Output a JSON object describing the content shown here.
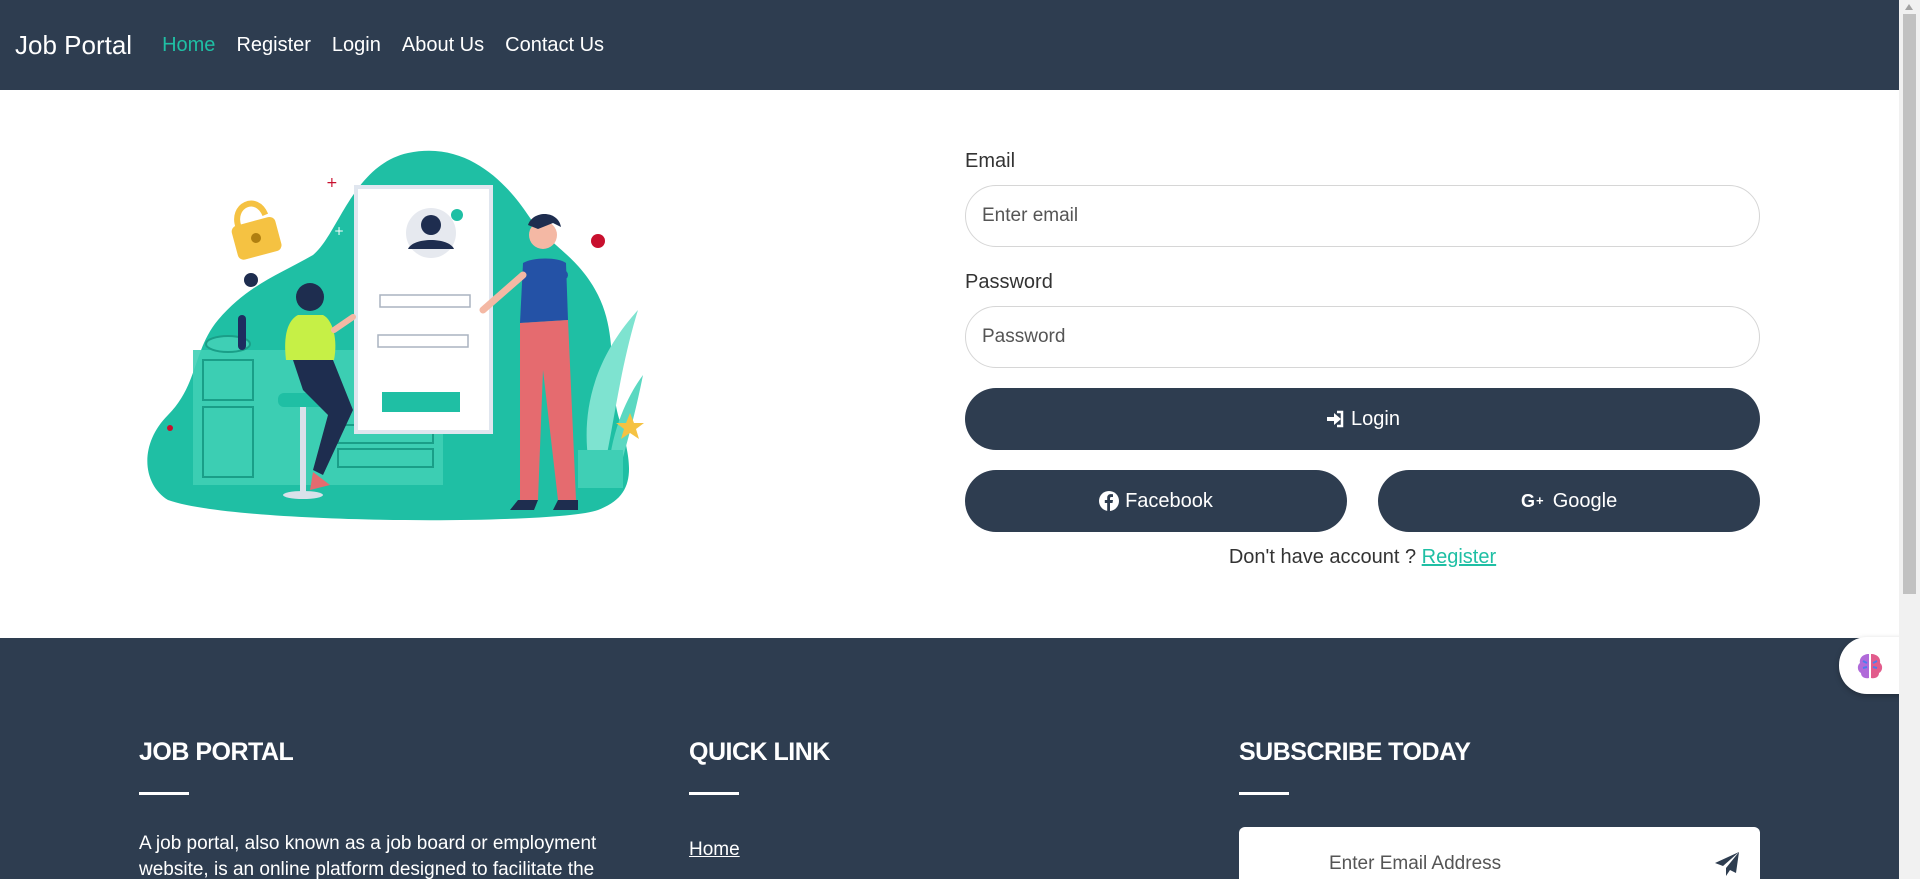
{
  "navbar": {
    "brand": "Job Portal",
    "links": [
      {
        "label": "Home",
        "active": true
      },
      {
        "label": "Register",
        "active": false
      },
      {
        "label": "Login",
        "active": false
      },
      {
        "label": "About Us",
        "active": false
      },
      {
        "label": "Contact Us",
        "active": false
      }
    ]
  },
  "login": {
    "email_label": "Email",
    "email_placeholder": "Enter email",
    "password_label": "Password",
    "password_placeholder": "Password",
    "login_button": "Login",
    "facebook_button": "Facebook",
    "google_button": "Google",
    "no_account_text": "Don't have account ?",
    "register_link": "Register"
  },
  "footer": {
    "about": {
      "heading": "JOB PORTAL",
      "text": "A job portal, also known as a job board or employment website, is an online platform designed to facilitate the"
    },
    "quick_link": {
      "heading": "QUICK LINK",
      "links": [
        "Home"
      ]
    },
    "subscribe": {
      "heading": "SUBSCRIBE TODAY",
      "placeholder": "Enter Email Address"
    }
  },
  "colors": {
    "navy": "#2e3d50",
    "teal": "#1fbfa4",
    "white": "#ffffff"
  },
  "icons": [
    "sign-in-icon",
    "facebook-icon",
    "google-plus-icon",
    "send-icon",
    "brain-icon"
  ]
}
